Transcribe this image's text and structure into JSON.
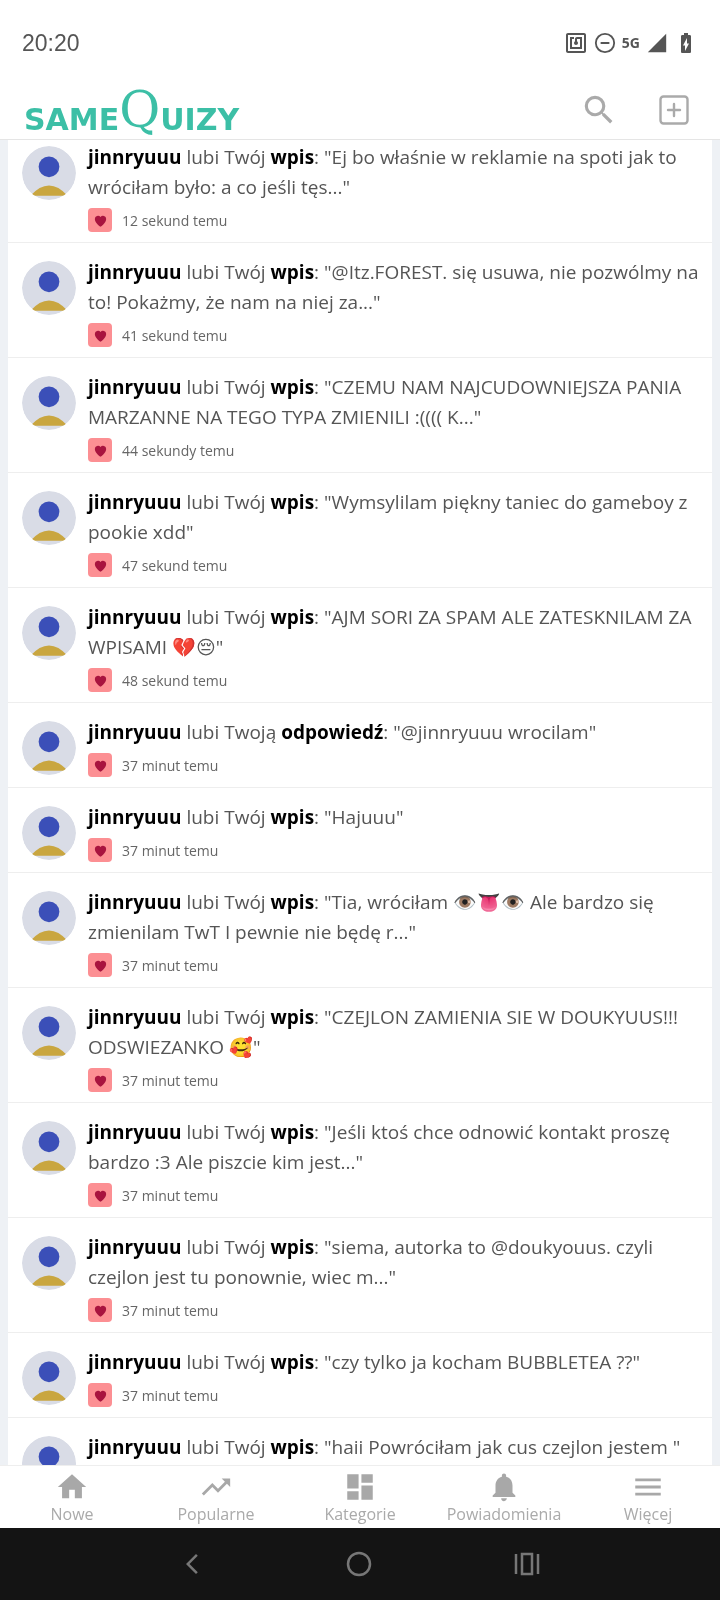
{
  "status_bar": {
    "time": "20:20",
    "network": "5G"
  },
  "header": {
    "logo": [
      "SAME",
      "Q",
      "UIZY"
    ]
  },
  "notifications": [
    {
      "text": "**jinnryuuu** lubi Twój **wpis**: \"Ej bo właśnie w reklamie na spoti jak to wróciłam było: a co jeśli tęs...\"",
      "time": "12 sekund temu"
    },
    {
      "text": "**jinnryuuu** lubi Twój **wpis**: \"@Itz.FOREST. się usuwa, nie pozwólmy na to! Pokażmy, że nam na niej za...\"",
      "time": "41 sekund temu"
    },
    {
      "text": "**jinnryuuu** lubi Twój **wpis**: \"CZEMU NAM NAJCUDOWNIEJSZA PANIA MARZANNE NA TEGO TYPA ZMIENILI :(((( K...\"",
      "time": "44 sekundy temu"
    },
    {
      "text": "**jinnryuuu** lubi Twój **wpis**: \"Wymsylilam piękny taniec do gameboy z pookie xdd\"",
      "time": "47 sekund temu"
    },
    {
      "text": "**jinnryuuu** lubi Twój **wpis**: \"AJM SORI ZA SPAM ALE ZATESKNILAM ZA WPISAMI 💔😔\"",
      "time": "48 sekund temu"
    },
    {
      "text": "**jinnryuuu** lubi Twoją **odpowiedź**: \"@jinnryuuu wrocilam\"",
      "time": "37 minut temu"
    },
    {
      "text": "**jinnryuuu** lubi Twój **wpis**: \"Hajuuu\"",
      "time": "37 minut temu"
    },
    {
      "text": "**jinnryuuu** lubi Twój **wpis**: \"Tia, wróciłam 👁️👅👁️ Ale bardzo się zmienilam TwT I pewnie nie będę r...\"",
      "time": "37 minut temu"
    },
    {
      "text": "**jinnryuuu** lubi Twój **wpis**: \"CZEJLON ZAMIENIA SIE W DOUKYUUS!!! ODSWIEZANKO 🥰\"",
      "time": "37 minut temu"
    },
    {
      "text": "**jinnryuuu** lubi Twój **wpis**: \"Jeśli ktoś chce odnowić kontakt proszę bardzo :3 Ale piszcie kim jest...\"",
      "time": "37 minut temu"
    },
    {
      "text": "**jinnryuuu** lubi Twój **wpis**: \"siema, autorka to @doukyouus. czyli czejlon jest tu ponownie, wiec m...\"",
      "time": "37 minut temu"
    },
    {
      "text": "**jinnryuuu** lubi Twój **wpis**: \"czy tylko ja kocham BUBBLETEA ??\"",
      "time": "37 minut temu"
    },
    {
      "text": "**jinnryuuu** lubi Twój **wpis**: \"haii Powróciłam jak cus czejlon jestem \""
    }
  ],
  "bottom_nav": [
    {
      "kind": "home",
      "label": "Nowe"
    },
    {
      "kind": "trending",
      "label": "Popularne"
    },
    {
      "kind": "categories",
      "label": "Kategorie"
    },
    {
      "kind": "bell",
      "label": "Powiadomienia"
    },
    {
      "kind": "menu",
      "label": "Więcej"
    }
  ]
}
